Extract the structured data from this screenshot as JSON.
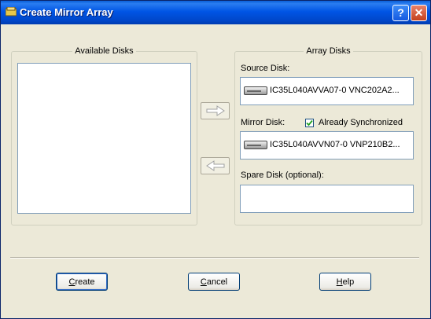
{
  "window": {
    "title": "Create Mirror Array"
  },
  "available": {
    "legend": "Available Disks",
    "items": []
  },
  "array": {
    "legend": "Array Disks",
    "source_label": "Source Disk:",
    "source_disk": "IC35L040AVVA07-0 VNC202A2...",
    "mirror_label": "Mirror Disk:",
    "already_sync_label": "Already Synchronized",
    "already_sync_checked": true,
    "mirror_disk": "IC35L040AVVN07-0 VNP210B2...",
    "spare_label": "Spare Disk (optional):",
    "spare_disk": ""
  },
  "buttons": {
    "create_first": "C",
    "create_rest": "reate",
    "cancel_first": "C",
    "cancel_rest": "ancel",
    "help_first": "H",
    "help_rest": "elp"
  },
  "icons": [
    "window-icon",
    "help-icon",
    "close-icon",
    "arrow-right-icon",
    "arrow-left-icon",
    "disk-icon",
    "checkmark-icon"
  ]
}
